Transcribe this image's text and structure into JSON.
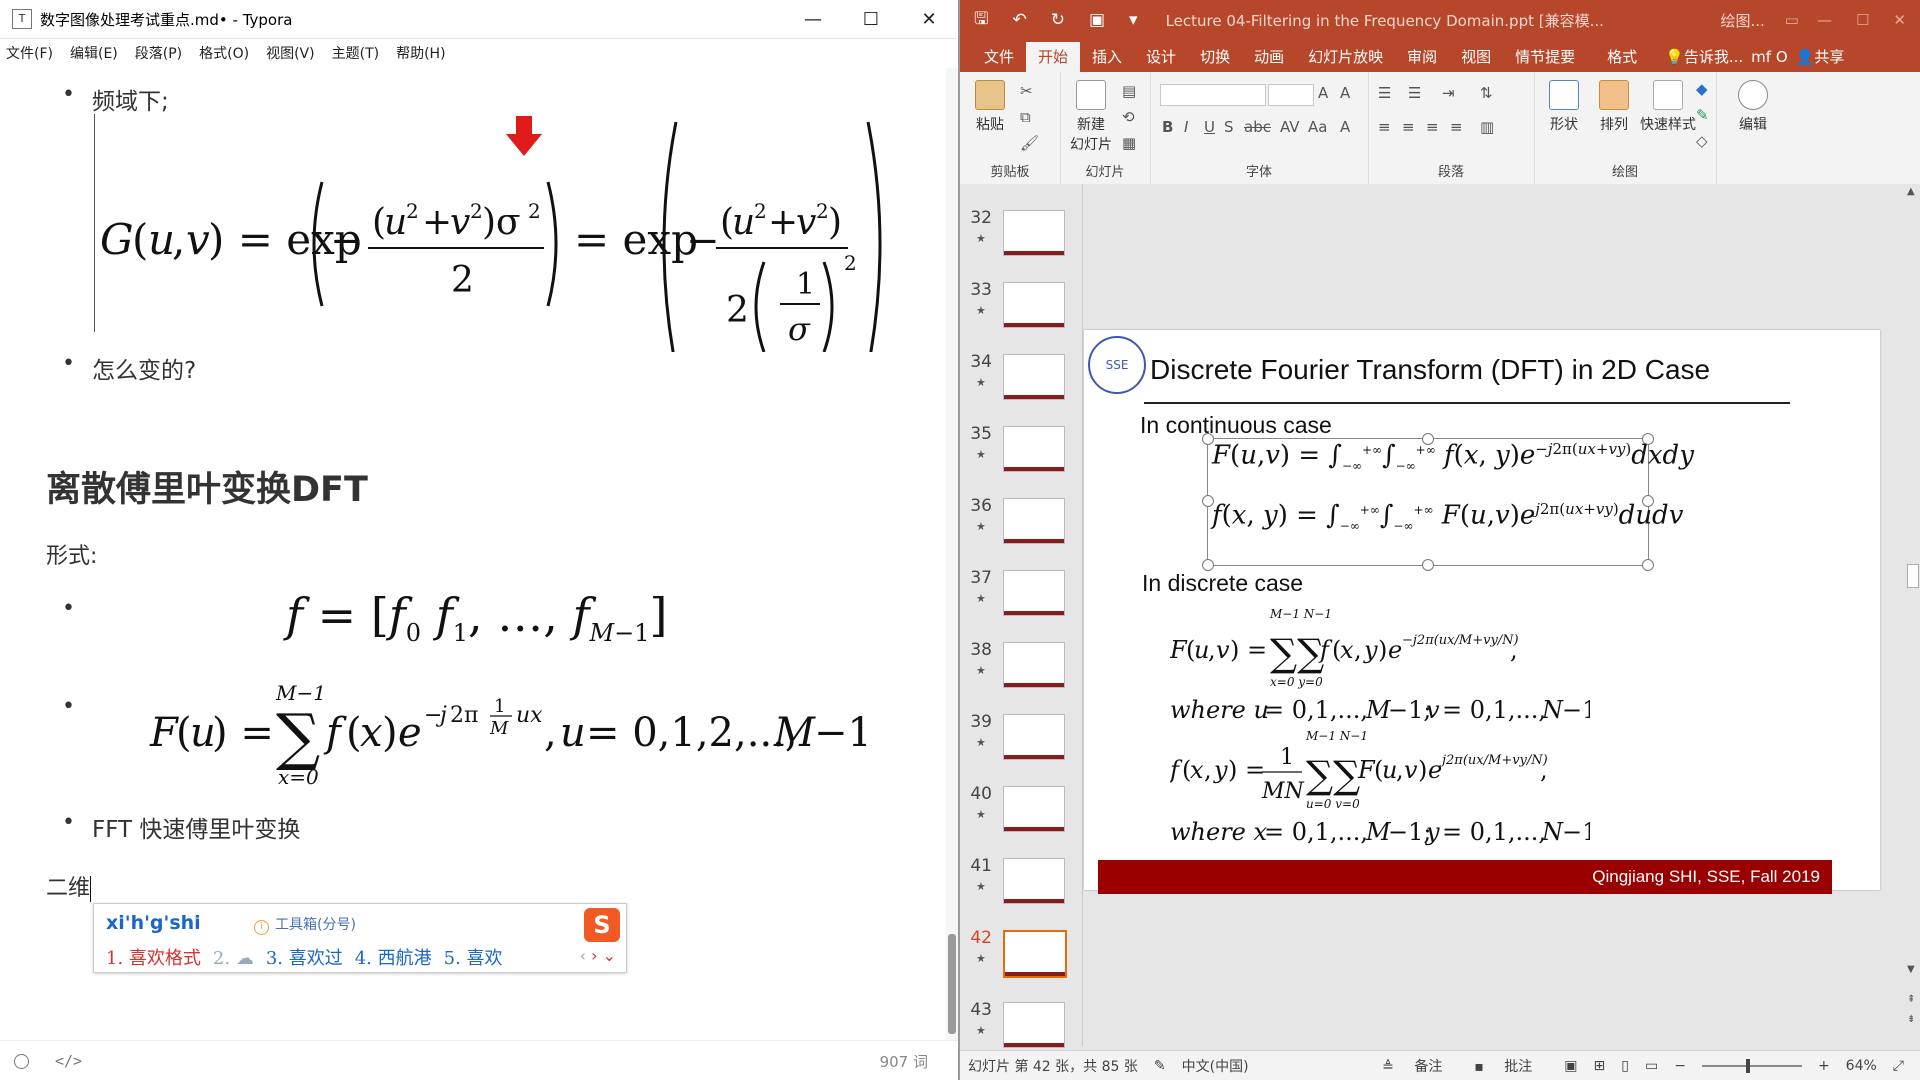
{
  "typora": {
    "icon": "T",
    "title": "数字图像处理考试重点.md• - Typora",
    "window_controls": [
      "—",
      "☐",
      "✕"
    ],
    "menu": [
      "文件(F)",
      "编辑(E)",
      "段落(P)",
      "格式(O)",
      "视图(V)",
      "主题(T)",
      "帮助(H)"
    ],
    "bullets": [
      "频域下;",
      "怎么变的?",
      "FFT 快速傅里叶变换"
    ],
    "heading": "离散傅里叶变换DFT",
    "form_label": "形式:",
    "typing": "二维",
    "ime": {
      "pinyin": "xi'h'g'shi",
      "toolbox": "工具箱(分号)",
      "candidates": [
        "1. 喜欢格式",
        "2.",
        "3. 喜欢过",
        "4. 西航港",
        "5. 喜欢"
      ],
      "logo": "S"
    },
    "status_word_count": "907 词"
  },
  "ppt": {
    "title": "Lecture 04-Filtering in the Frequency Domain.ppt [兼容模...",
    "context_title": "绘图...",
    "tabs": [
      "文件",
      "开始",
      "插入",
      "设计",
      "切换",
      "动画",
      "幻灯片放映",
      "审阅",
      "视图",
      "情节提要",
      "格式"
    ],
    "tab_right": [
      "告诉我...",
      "mf O",
      "共享"
    ],
    "groups": [
      {
        "label": "剪贴板",
        "buttons": [
          "粘贴"
        ]
      },
      {
        "label": "幻灯片",
        "buttons": [
          "新建",
          "幻灯片"
        ]
      },
      {
        "label": "字体",
        "buttons": []
      },
      {
        "label": "段落",
        "buttons": []
      },
      {
        "label": "绘图",
        "buttons": [
          "形状",
          "排列",
          "快速样式"
        ]
      },
      {
        "label": "",
        "buttons": [
          "编辑"
        ]
      }
    ],
    "slide_numbers": [
      "32",
      "33",
      "34",
      "35",
      "36",
      "37",
      "38",
      "39",
      "40",
      "41",
      "42",
      "43"
    ],
    "current_slide": "42",
    "slide": {
      "logo": "SSE",
      "title": "Discrete Fourier Transform (DFT) in 2D Case",
      "continuous": "In continuous case",
      "discrete": "In discrete case",
      "footer": "Qingjiang SHI, SSE, Fall 2019"
    },
    "status": {
      "slide_info": "幻灯片 第 42 张，共 85 张",
      "language": "中文(中国)",
      "notes": "备注",
      "comments": "批注",
      "zoom": "64%"
    }
  },
  "accent": {
    "ppt_red": "#b7472a",
    "footer_red": "#9a0000",
    "ime_red": "#e02d2d",
    "ime_blue": "#1a66c9",
    "cursor_arrow": "#e11b1b"
  }
}
